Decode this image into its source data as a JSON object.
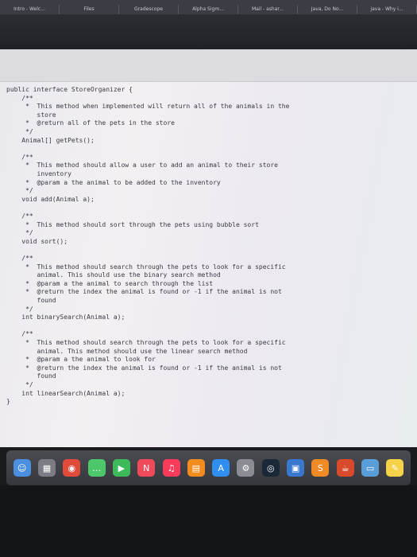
{
  "browser": {
    "tabs": [
      "Intro - Welc...",
      "Files",
      "Gradescope",
      "Alpha Sigm...",
      "Mail - ashar...",
      "Java, Do No...",
      "java - Why i..."
    ]
  },
  "code": {
    "lines": [
      "public interface StoreOrganizer {",
      "    /**",
      "     *  This method when implemented will return all of the animals in the",
      "        store",
      "     *  @return all of the pets in the store",
      "     */",
      "    Animal[] getPets();",
      "",
      "    /**",
      "     *  This method should allow a user to add an animal to their store",
      "        inventory",
      "     *  @param a the animal to be added to the inventory",
      "     */",
      "    void add(Animal a);",
      "",
      "    /**",
      "     *  This method should sort through the pets using bubble sort",
      "     */",
      "    void sort();",
      "",
      "    /**",
      "     *  This method should search through the pets to look for a specific",
      "        animal. This should use the binary search method",
      "     *  @param a the animal to search through the list",
      "     *  @return the index the animal is found or -1 if the animal is not",
      "        found",
      "     */",
      "    int binarySearch(Animal a);",
      "",
      "    /**",
      "     *  This method should search through the pets to look for a specific",
      "        animal. This method should use the linear search method",
      "     *  @param a the animal to look for",
      "     *  @return the index the animal is found or -1 if the animal is not",
      "        found",
      "     */",
      "    int linearSearch(Animal a);",
      "}"
    ]
  },
  "dock": {
    "icons": [
      {
        "name": "finder-icon",
        "color": "#4a8fe0",
        "glyph": "☺"
      },
      {
        "name": "launchpad-icon",
        "color": "#7a7d85",
        "glyph": "▦"
      },
      {
        "name": "chrome-icon",
        "color": "#e04b3a",
        "glyph": "◉"
      },
      {
        "name": "messages-icon",
        "color": "#4cc76a",
        "glyph": "…"
      },
      {
        "name": "facetime-icon",
        "color": "#3dbb5a",
        "glyph": "▶"
      },
      {
        "name": "news-icon",
        "color": "#f04a5a",
        "glyph": "N"
      },
      {
        "name": "music-icon",
        "color": "#fa3c5a",
        "glyph": "♫"
      },
      {
        "name": "books-icon",
        "color": "#f28c1e",
        "glyph": "▤"
      },
      {
        "name": "app-store-icon",
        "color": "#2f8ef0",
        "glyph": "A"
      },
      {
        "name": "system-preferences-icon",
        "color": "#8a8d94",
        "glyph": "⚙"
      },
      {
        "name": "steam-icon",
        "color": "#1b2838",
        "glyph": "◎"
      },
      {
        "name": "photos-icon",
        "color": "#3a78d0",
        "glyph": "▣"
      },
      {
        "name": "sublime-icon",
        "color": "#f08a24",
        "glyph": "S"
      },
      {
        "name": "java-icon",
        "color": "#d84a2a",
        "glyph": "☕"
      },
      {
        "name": "preview-icon",
        "color": "#5a9ed8",
        "glyph": "▭"
      },
      {
        "name": "notes-icon",
        "color": "#f6d24a",
        "glyph": "✎"
      }
    ]
  }
}
